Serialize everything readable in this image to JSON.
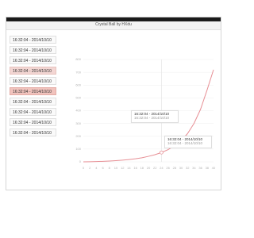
{
  "app": {
    "title": "Crystal Ball by HXdu"
  },
  "sidebar": {
    "items": [
      {
        "label": "16:32:04 - 2014/10/10",
        "state": "normal"
      },
      {
        "label": "16:32:04 - 2014/10/10",
        "state": "normal"
      },
      {
        "label": "16:32:04 - 2014/10/10",
        "state": "normal"
      },
      {
        "label": "16:32:04 - 2014/10/10",
        "state": "light"
      },
      {
        "label": "16:32:04 - 2014/10/10",
        "state": "normal"
      },
      {
        "label": "16:32:04 - 2014/10/10",
        "state": "strong"
      },
      {
        "label": "16:32:04 - 2014/10/10",
        "state": "normal"
      },
      {
        "label": "16:32:04 - 2014/10/10",
        "state": "normal"
      },
      {
        "label": "16:32:04 - 2014/10/10",
        "state": "normal"
      },
      {
        "label": "16:32:04 - 2014/10/10",
        "state": "normal"
      }
    ]
  },
  "tooltip1": {
    "line1": "16:32:04 - 2014/10/10",
    "line2": "16:32:04 - 2014/10/10"
  },
  "tooltip2": {
    "line1": "16:32:04 - 2014/10/10",
    "line2": "16:32:04 - 2014/10/10"
  },
  "colors": {
    "curve": "#e78f95",
    "accent_light": "#f3d6d3",
    "accent_strong": "#f1c3bd"
  },
  "chart_data": {
    "type": "line",
    "xlabel": "",
    "ylabel": "",
    "yticks": [
      800,
      700,
      600,
      500,
      400,
      300,
      200,
      100,
      0
    ],
    "xticks": [
      0,
      2,
      4,
      6,
      8,
      10,
      12,
      14,
      16,
      18,
      20,
      22,
      24,
      26,
      28,
      30,
      32,
      34,
      36,
      38,
      40
    ],
    "xlim": [
      0,
      40
    ],
    "ylim": [
      0,
      800
    ],
    "series": [
      {
        "x": [
          0,
          2,
          4,
          6,
          8,
          10,
          12,
          14,
          16,
          18,
          20,
          22,
          24,
          26,
          28,
          30,
          32,
          34,
          36,
          38,
          40
        ],
        "values": [
          0,
          1,
          2,
          4,
          6,
          9,
          13,
          18,
          24,
          32,
          43,
          56,
          73,
          95,
          125,
          165,
          220,
          300,
          410,
          560,
          720
        ]
      }
    ],
    "highlight_x": 24
  }
}
